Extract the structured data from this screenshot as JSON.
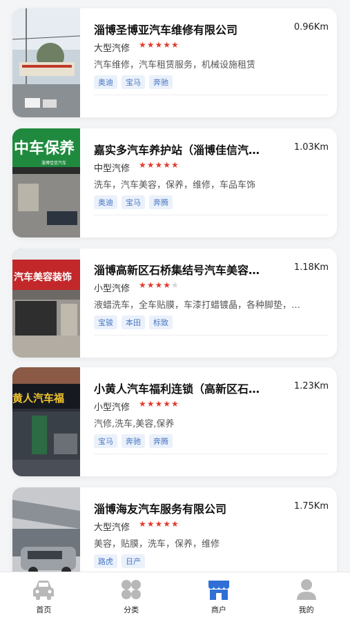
{
  "shops": [
    {
      "name": "淄博圣博亚汽车维修有限公司",
      "distance": "0.96Km",
      "type": "大型汽修",
      "rating": 5,
      "stars": "★★★★★",
      "services": "汽车维修，汽车租赁服务，机械设施租赁",
      "brands": [
        "奥迪",
        "宝马",
        "奔驰"
      ]
    },
    {
      "name": "嘉实多汽车养护站（淄博佳信汽…",
      "distance": "1.03Km",
      "type": "中型汽修",
      "rating": 5,
      "stars": "★★★★★",
      "services": "洗车，汽车美容，保养，维修，车品车饰",
      "brands": [
        "奥迪",
        "宝马",
        "奔腾"
      ],
      "sign": "中车保养",
      "subsign": "淄博佳信汽车"
    },
    {
      "name": "淄博高新区石桥集结号汽车美容…",
      "distance": "1.18Km",
      "type": "小型汽修",
      "rating": 4,
      "stars": "★★★★",
      "stars_off": "★",
      "services": "液蜡洗车，全车贴膜，车漆打蜡镀晶，各种脚垫，…",
      "brands": [
        "宝骏",
        "本田",
        "标致"
      ],
      "sign": "汽车美容装饰"
    },
    {
      "name": "小黄人汽车福利连锁（高新区石…",
      "distance": "1.23Km",
      "type": "小型汽修",
      "rating": 5,
      "stars": "★★★★★",
      "services": "汽修,洗车,美容,保养",
      "brands": [
        "宝马",
        "奔驰",
        "奔腾"
      ],
      "sign": "黄人汽车福"
    },
    {
      "name": "淄博海友汽车服务有限公司",
      "distance": "1.75Km",
      "type": "大型汽修",
      "rating": 5,
      "stars": "★★★★★",
      "services": "美容，贴膜，洗车，保养，维修",
      "brands": [
        "路虎",
        "日产"
      ]
    }
  ],
  "tabs": [
    {
      "label": "首页",
      "icon": "car-icon",
      "active": false
    },
    {
      "label": "分类",
      "icon": "grid-icon",
      "active": false
    },
    {
      "label": "商户",
      "icon": "store-icon",
      "active": true
    },
    {
      "label": "我的",
      "icon": "user-icon",
      "active": false
    }
  ],
  "colors": {
    "accent": "#2f6fd6",
    "star": "#e23b2e",
    "tag_text": "#4a78c4",
    "tag_bg": "#eaf1fb",
    "inactive_icon": "#b8b8b8"
  }
}
